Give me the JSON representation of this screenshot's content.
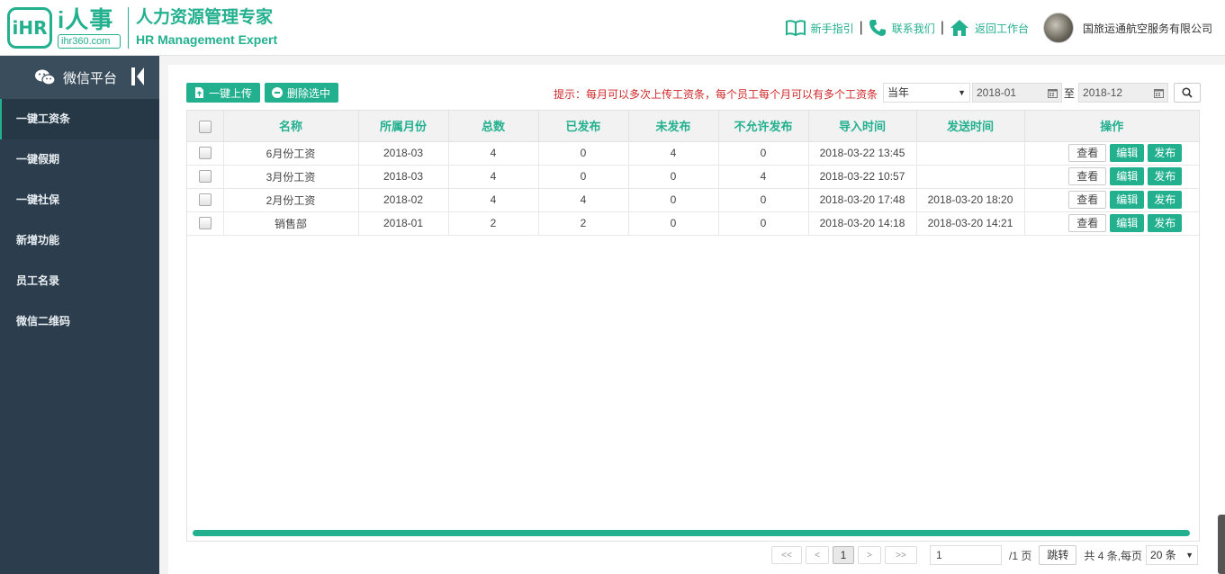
{
  "header": {
    "logo_mark": "iHR",
    "logo_cn": "i人事",
    "logo_site": "ihr360.com",
    "slogan_cn": "人力资源管理专家",
    "slogan_en": "HR Management Expert",
    "links": {
      "guide": "新手指引",
      "contact": "联系我们",
      "back": "返回工作台"
    },
    "separator": "|",
    "company": "国旅运通航空服务有限公司"
  },
  "sidebar": {
    "title": "微信平台",
    "items": [
      {
        "label": "一键工资条",
        "active": true
      },
      {
        "label": "一键假期",
        "active": false
      },
      {
        "label": "一键社保",
        "active": false
      },
      {
        "label": "新增功能",
        "active": false
      },
      {
        "label": "员工名录",
        "active": false
      },
      {
        "label": "微信二维码",
        "active": false
      }
    ]
  },
  "toolbar": {
    "upload_label": "一键上传",
    "delete_label": "删除选中",
    "hint": "提示：每月可以多次上传工资条，每个员工每个月可以有多个工资条",
    "period_select": "当年",
    "date_from": "2018-01",
    "to_label": "至",
    "date_to": "2018-12"
  },
  "table": {
    "columns": [
      "名称",
      "所属月份",
      "总数",
      "已发布",
      "未发布",
      "不允许发布",
      "导入时间",
      "发送时间",
      "操作"
    ],
    "rows": [
      {
        "name": "6月份工资",
        "month": "2018-03",
        "total": "4",
        "published": "0",
        "unpublished": "4",
        "not_allowed": "0",
        "import_time": "2018-03-22 13:45",
        "send_time": ""
      },
      {
        "name": "3月份工资",
        "month": "2018-03",
        "total": "4",
        "published": "0",
        "unpublished": "0",
        "not_allowed": "4",
        "import_time": "2018-03-22 10:57",
        "send_time": ""
      },
      {
        "name": "2月份工资",
        "month": "2018-02",
        "total": "4",
        "published": "4",
        "unpublished": "0",
        "not_allowed": "0",
        "import_time": "2018-03-20 17:48",
        "send_time": "2018-03-20 18:20"
      },
      {
        "name": "销售部",
        "month": "2018-01",
        "total": "2",
        "published": "2",
        "unpublished": "0",
        "not_allowed": "0",
        "import_time": "2018-03-20 14:18",
        "send_time": "2018-03-20 14:21"
      }
    ],
    "actions": {
      "view": "查看",
      "edit": "编辑",
      "publish": "发布"
    }
  },
  "pager": {
    "first": "<<",
    "prev": "<",
    "current": "1",
    "next": ">",
    "last": ">>",
    "page_input": "1",
    "total_pages": "/1 页",
    "jump_label": "跳转",
    "summary": "共 4 条,每页",
    "per_page": "20 条"
  },
  "colors": {
    "accent": "#23b08f",
    "sidebar_bg": "#2c3e4d",
    "hint_red": "#d0282a"
  }
}
